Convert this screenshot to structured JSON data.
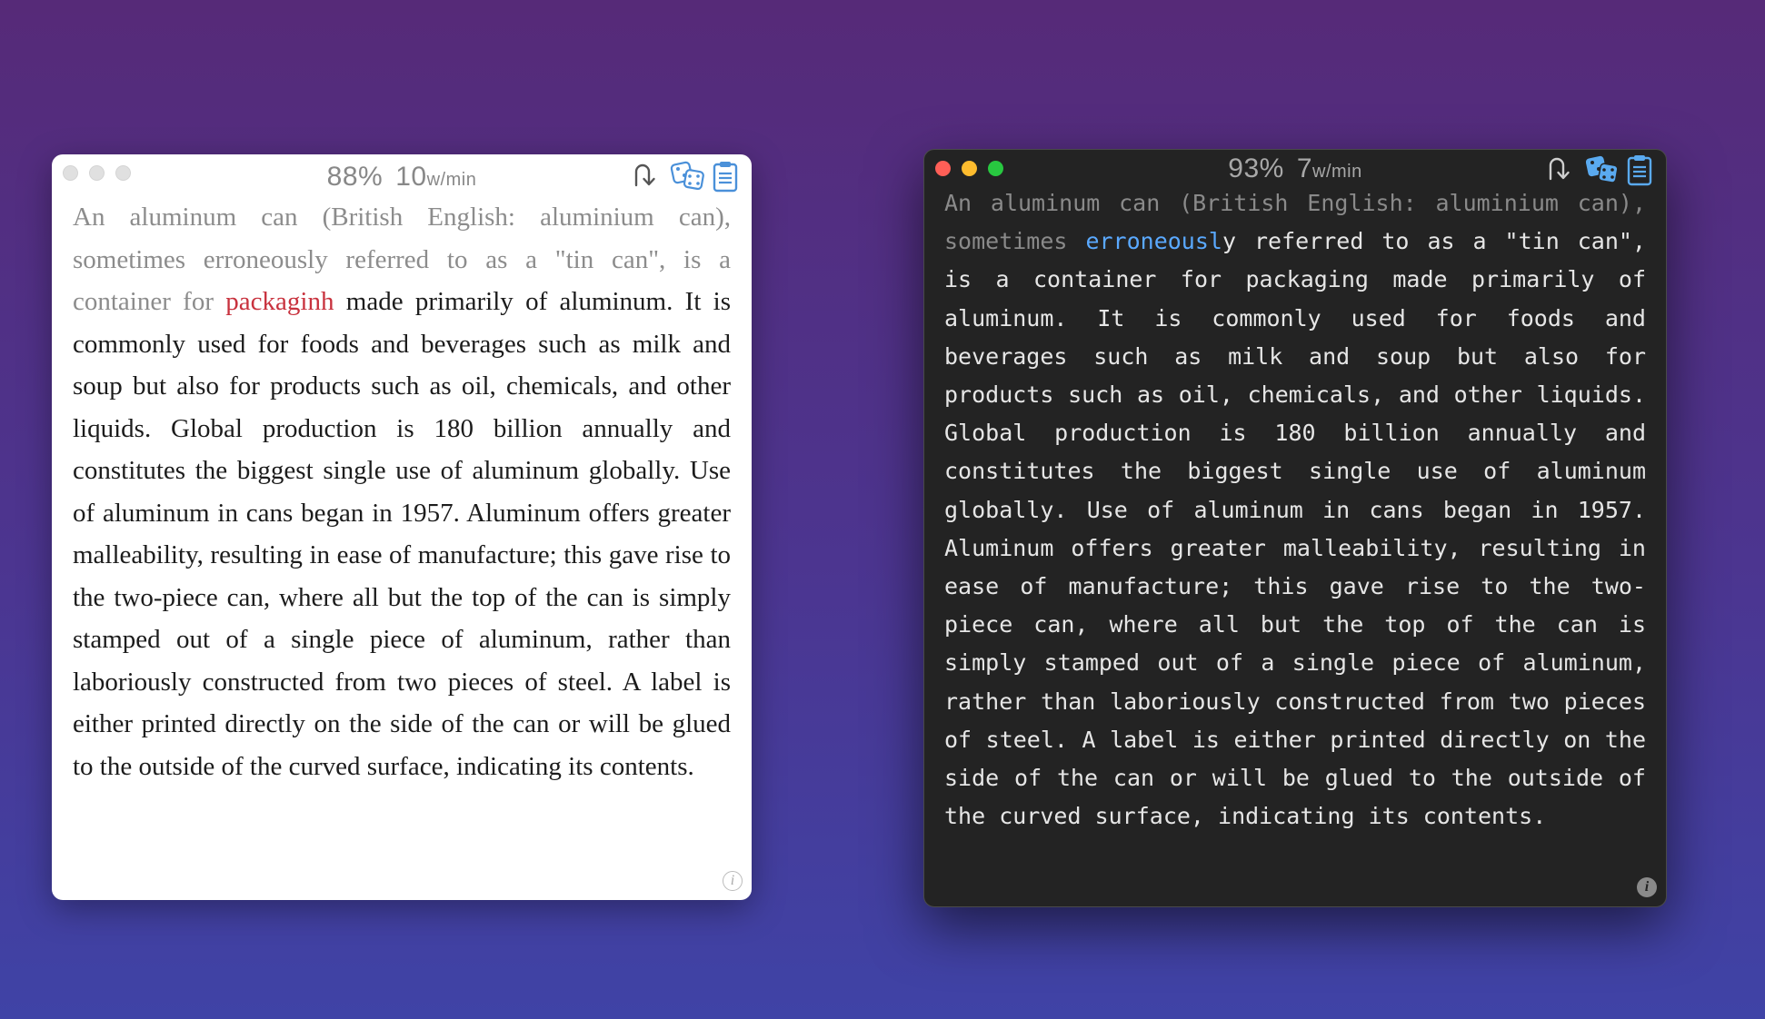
{
  "light_window": {
    "accuracy": "88%",
    "speed_value": "10",
    "speed_unit": "w/min",
    "completed_text": "An aluminum can (British English: aluminium can), sometimes erroneously referred to as a \"tin can\", is a container for ",
    "error_word": "packaginh",
    "remaining_text": " made primarily of aluminum. It is commonly used for foods and beverages such as milk and soup but also for products such as oil, chemicals, and other liquids. Global production is 180 billion annually and constitutes the biggest single use of aluminum globally. Use of aluminum in cans began in 1957. Aluminum offers greater malleability, resulting in ease of manufacture; this gave rise to the two-piece can, where all but the top of the can is simply stamped out of a single piece of aluminum, rather than laboriously constructed from two pieces of steel. A label is either printed directly on the side of the can or will be glued to the outside of the curved surface, indicating its contents.",
    "info_label": "i"
  },
  "dark_window": {
    "accuracy": "93%",
    "speed_value": "7",
    "speed_unit": "w/min",
    "completed_text": "An aluminum can (British English: aluminium can), sometimes ",
    "current_partial": "erroneousl",
    "remaining_text": "y referred to as a \"tin can\", is a container for packaging made primarily of aluminum. It is commonly used for foods and beverages such as milk and soup but also for products such as oil, chemicals, and other liquids. Global production is 180 billion annually and constitutes the biggest single use of aluminum globally. Use of aluminum in cans began in 1957. Aluminum offers greater malleability, resulting in ease of manufacture; this gave rise to the two-piece can, where all but the top of the can is simply stamped out of a single piece of aluminum, rather than laboriously constructed from two pieces of steel. A label is either printed directly on the side of the can or will be glued to the outside of the curved surface, indicating its contents.",
    "info_label": "i"
  },
  "colors": {
    "light_error": "#c8323e",
    "dark_current": "#5aa9ff",
    "tool_icon_light": "#4a90d9",
    "tool_icon_dark": "#5aaaf0"
  },
  "icons": [
    "restart-arrow-icon",
    "dice-icon",
    "clipboard-icon",
    "info-icon"
  ]
}
